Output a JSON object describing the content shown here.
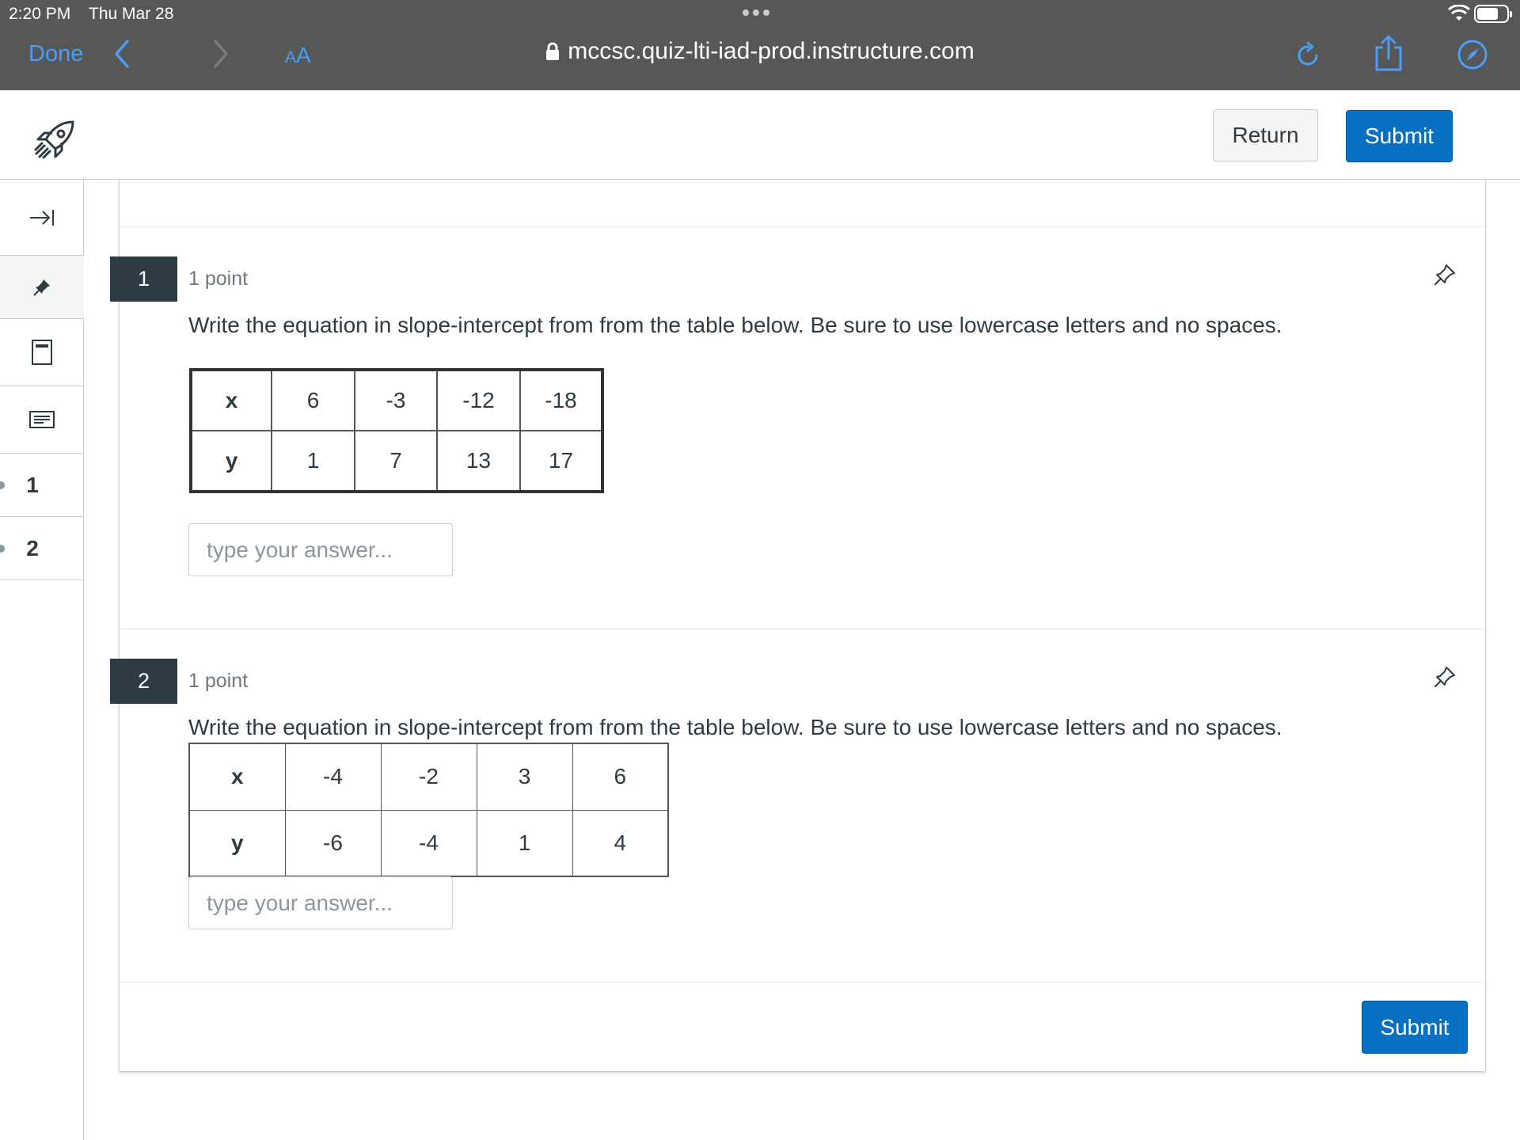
{
  "status_bar": {
    "time": "2:20 PM",
    "date": "Thu Mar 28"
  },
  "browser": {
    "done_label": "Done",
    "text_size_small": "A",
    "text_size_big": "A",
    "url": "mccsc.quiz-lti-iad-prod.instructure.com"
  },
  "header": {
    "return_label": "Return",
    "submit_label": "Submit"
  },
  "sidebar": {
    "question_links": [
      "1",
      "2"
    ]
  },
  "questions": [
    {
      "number": "1",
      "points": "1 point",
      "text": "Write the equation in slope-intercept from from the table below. Be sure to use lowercase letters and no spaces.",
      "table": {
        "x_label": "x",
        "x_values": [
          "6",
          "-3",
          "-12",
          "-18"
        ],
        "y_label": "y",
        "y_values": [
          "1",
          "7",
          "13",
          "17"
        ]
      },
      "answer_placeholder": "type your answer..."
    },
    {
      "number": "2",
      "points": "1 point",
      "text": "Write the equation in slope-intercept from from the table below. Be sure to use lowercase letters and no spaces.",
      "table": {
        "x_label": "x",
        "x_values": [
          "-4",
          "-2",
          "3",
          "6"
        ],
        "y_label": "y",
        "y_values": [
          "-6",
          "-4",
          "1",
          "4"
        ]
      },
      "answer_placeholder": "type your answer..."
    }
  ],
  "footer": {
    "submit_label": "Submit"
  },
  "colors": {
    "chrome_bg": "#575757",
    "ios_blue": "#4a9ff5",
    "primary_button": "#0770c2",
    "question_badge": "#2d3b45",
    "text": "#2d3b45"
  }
}
